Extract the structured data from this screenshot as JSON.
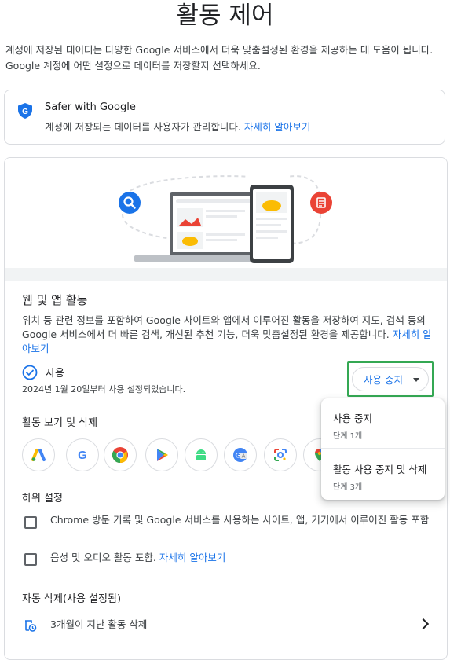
{
  "page": {
    "title": "활동 제어",
    "intro": "계정에 저장된 데이터는 다양한 Google 서비스에서 더욱 맞춤설정된 환경을 제공하는 데 도움이 됩니다. Google 계정에 어떤 설정으로 데이터를 저장할지 선택하세요."
  },
  "safer": {
    "icon": "google-shield-icon",
    "title": "Safer with Google",
    "desc": "계정에 저장되는 데이터를 사용자가 관리합니다.",
    "link": "자세히 알아보기"
  },
  "web_app_activity": {
    "title": "웹 및 앱 활동",
    "desc": "위치 등 관련 정보를 포함하여 Google 사이트와 앱에서 이루어진 활동을 저장하여 지도, 검색 등의 Google 서비스에서 더 빠른 검색, 개선된 추천 기능, 더욱 맞춤설정된 환경을 제공합니다.",
    "link": "자세히 알아보기",
    "status": "사용",
    "status_date": "2024년 1월 20일부터 사용 설정되었습니다.",
    "pause_button": "사용 중지",
    "view_delete_title": "활동 보기 및 삭제",
    "apps": [
      "google-ads-icon",
      "google-search-icon",
      "chrome-icon",
      "play-store-icon",
      "android-icon",
      "google-translate-icon",
      "google-lens-icon",
      "google-maps-icon"
    ],
    "sub_settings_title": "하위 설정",
    "checkbox_chrome": "Chrome 방문 기록 및 Google 서비스를 사용하는 사이트, 앱, 기기에서 이루어진 활동 포함",
    "checkbox_audio": "음성 및 오디오 활동 포함.",
    "checkbox_audio_link": "자세히 알아보기",
    "auto_delete_title": "자동 삭제(사용 설정됨)",
    "auto_delete_item": "3개월이 지난 활동 삭제"
  },
  "menu": {
    "items": [
      {
        "label": "사용 중지",
        "sub": "단계 1개"
      },
      {
        "label": "활동 사용 중지 및 삭제",
        "sub": "단계 3개"
      }
    ]
  },
  "colors": {
    "accent": "#1a73e8",
    "highlight": "#34a853",
    "search_icon": "#1a73e8",
    "doc_icon": "#ea4335"
  }
}
